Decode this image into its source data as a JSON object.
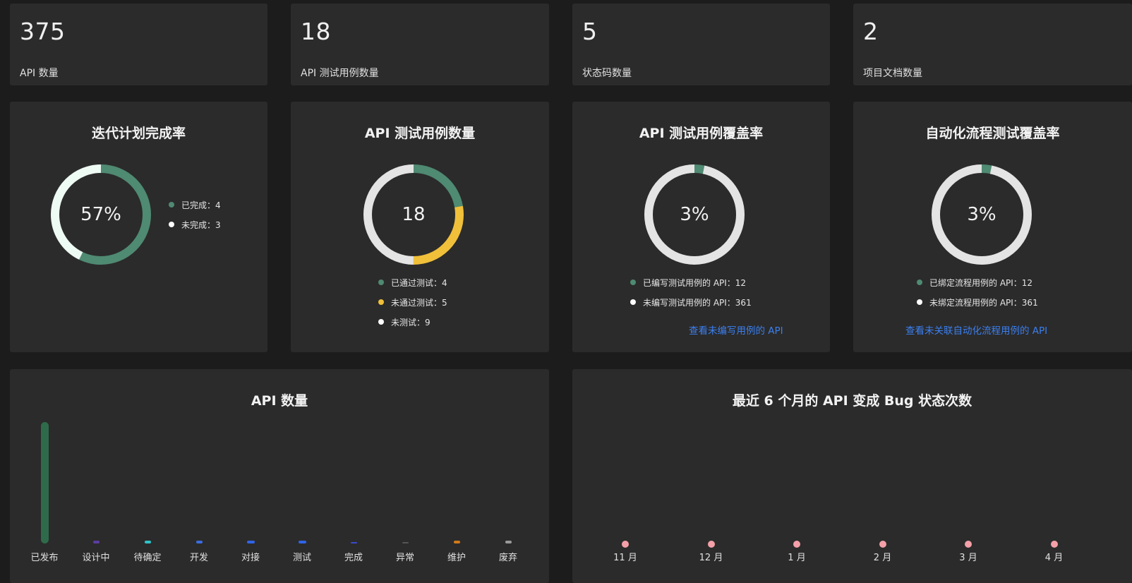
{
  "stats": [
    {
      "value": "375",
      "label": "API 数量"
    },
    {
      "value": "18",
      "label": "API 测试用例数量"
    },
    {
      "value": "5",
      "label": "状态码数量"
    },
    {
      "value": "2",
      "label": "项目文档数量"
    }
  ],
  "colors": {
    "green": "#4f8a72",
    "yellow": "#f0c03a",
    "white": "#f2f2f2",
    "grey": "#e4e4e4",
    "mint": "#eefaf4",
    "link": "#3b7ff0",
    "pink": "#f4a0a8"
  },
  "iteration": {
    "title": "迭代计划完成率",
    "center": "57%",
    "legend": [
      "已完成：4",
      "未完成：3"
    ]
  },
  "api_cases": {
    "title": "API 测试用例数量",
    "center": "18",
    "legend": [
      "已通过测试：4",
      "未通过测试：5",
      "未测试：9"
    ]
  },
  "api_coverage": {
    "title": "API 测试用例覆盖率",
    "center": "3%",
    "legend": [
      "已编写测试用例的 API：12",
      "未编写测试用例的 API：361"
    ],
    "link": "查看未编写用例的 API"
  },
  "auto_coverage": {
    "title": "自动化流程测试覆盖率",
    "center": "3%",
    "legend": [
      "已绑定流程用例的 API：12",
      "未绑定流程用例的 API：361"
    ],
    "link": "查看未关联自动化流程用例的 API"
  },
  "api_count_chart": {
    "title": "API 数量"
  },
  "bug_chart": {
    "title": "最近 6 个月的 API 变成 Bug 状态次数"
  },
  "chart_data": [
    {
      "type": "pie",
      "title": "迭代计划完成率",
      "categories": [
        "已完成",
        "未完成"
      ],
      "values": [
        4,
        3
      ],
      "colors": [
        "#4f8a72",
        "#eefaf4"
      ]
    },
    {
      "type": "pie",
      "title": "API 测试用例数量",
      "categories": [
        "已通过测试",
        "未通过测试",
        "未测试"
      ],
      "values": [
        4,
        5,
        9
      ],
      "colors": [
        "#4f8a72",
        "#f0c03a",
        "#e4e4e4"
      ]
    },
    {
      "type": "pie",
      "title": "API 测试用例覆盖率",
      "categories": [
        "已编写测试用例的 API",
        "未编写测试用例的 API"
      ],
      "values": [
        12,
        361
      ],
      "colors": [
        "#4f8a72",
        "#e4e4e4"
      ]
    },
    {
      "type": "pie",
      "title": "自动化流程测试覆盖率",
      "categories": [
        "已绑定流程用例的 API",
        "未绑定流程用例的 API"
      ],
      "values": [
        12,
        361
      ],
      "colors": [
        "#4f8a72",
        "#e4e4e4"
      ]
    },
    {
      "type": "bar",
      "title": "API 数量",
      "categories": [
        "已发布",
        "设计中",
        "待确定",
        "开发",
        "对接",
        "测试",
        "完成",
        "异常",
        "维护",
        "废弃"
      ],
      "values": [
        349,
        1,
        2,
        2,
        8,
        6,
        0,
        0,
        1,
        1
      ],
      "colors": [
        "#2f6b4a",
        "#5b3da0",
        "#2ec4c9",
        "#3a6de0",
        "#2f64e8",
        "#2f64e8",
        "#3a4bd0",
        "#555555",
        "#d07a1a",
        "#9a9a9a"
      ]
    },
    {
      "type": "scatter",
      "title": "最近 6 个月的 API 变成 Bug 状态次数",
      "categories": [
        "11 月",
        "12 月",
        "1 月",
        "2 月",
        "3 月",
        "4 月"
      ],
      "values": [
        0,
        0,
        0,
        0,
        0,
        0
      ],
      "colors": [
        "#f4a0a8"
      ]
    }
  ]
}
